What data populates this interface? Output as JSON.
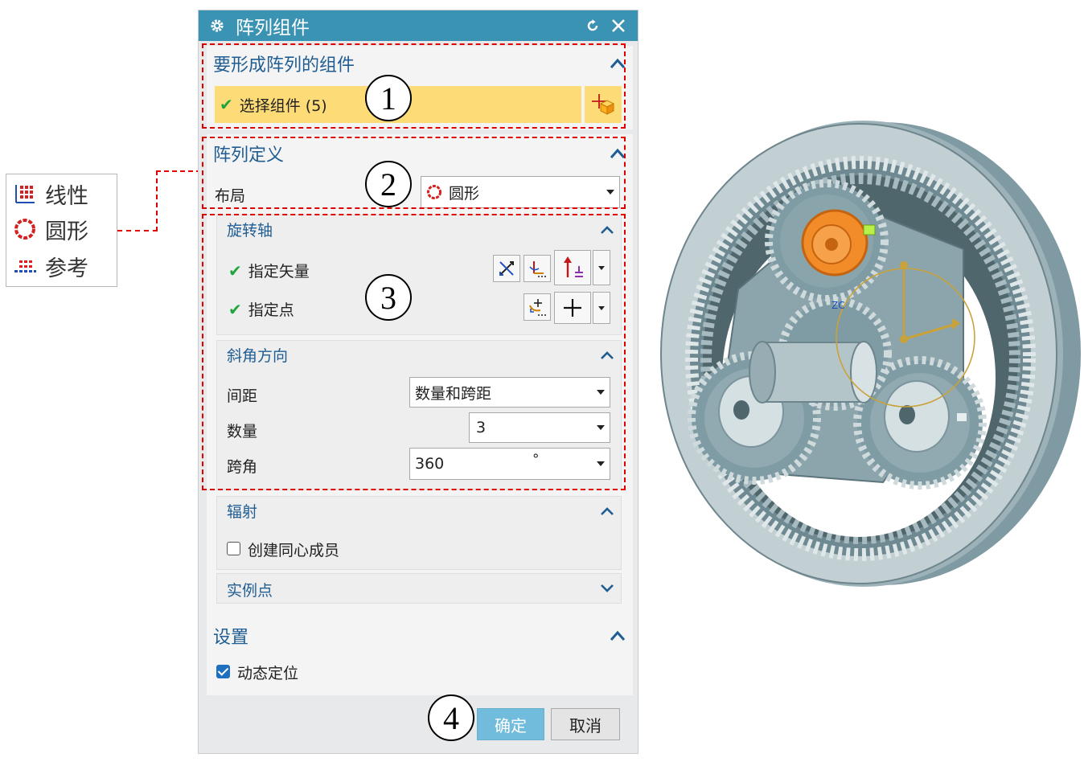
{
  "legend": {
    "items": [
      {
        "label": "线性",
        "icon": "linear-grid-icon"
      },
      {
        "label": "圆形",
        "icon": "circular-icon"
      },
      {
        "label": "参考",
        "icon": "reference-icon"
      }
    ]
  },
  "dialog": {
    "title": "阵列组件",
    "components_section": {
      "title": "要形成阵列的组件",
      "select_label": "选择组件 (5)"
    },
    "definition_section": {
      "title": "阵列定义",
      "layout_label": "布局",
      "layout_value": "圆形"
    },
    "rotation_axis": {
      "title": "旋转轴",
      "vector_label": "指定矢量",
      "point_label": "指定点"
    },
    "bevel_direction": {
      "title": "斜角方向",
      "spacing_label": "间距",
      "spacing_value": "数量和跨距",
      "count_label": "数量",
      "count_value": "3",
      "span_label": "跨角",
      "span_value": "360",
      "span_unit": "°"
    },
    "radiation": {
      "title": "辐射",
      "concentric_label": "创建同心成员"
    },
    "instance_points": {
      "title": "实例点"
    },
    "settings": {
      "title": "设置",
      "dynamic_label": "动态定位"
    },
    "buttons": {
      "ok": "确定",
      "cancel": "取消"
    }
  },
  "callouts": [
    "1",
    "2",
    "3",
    "4"
  ],
  "colors": {
    "title_bar": "#3a93b3",
    "section_title": "#1f5d92",
    "selected_row": "#fddc78",
    "callout_border": "#e00000",
    "ok_button": "#71bcdc",
    "gear_body": "#8ea6ad",
    "highlight_gear": "#f28c28"
  }
}
